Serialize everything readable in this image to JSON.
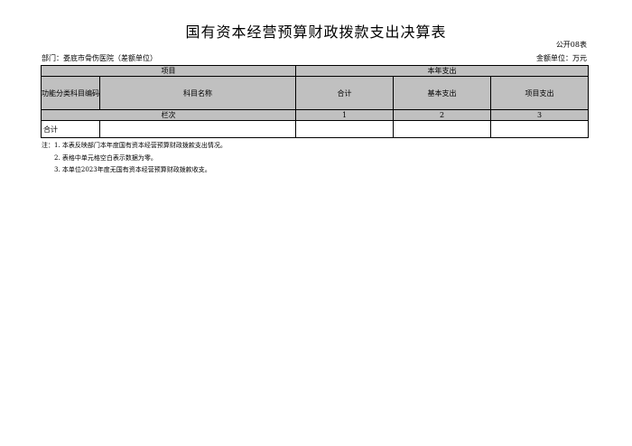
{
  "title": "国有资本经营预算财政拨款支出决算表",
  "form_no": "公开08表",
  "department": "部门：娄底市骨伤医院（差额单位）",
  "unit": "金额单位：万元",
  "table": {
    "header_project": "项目",
    "header_current_year": "本年支出",
    "col_code": "功能分类科目编码",
    "col_name": "科目名称",
    "col_total": "合计",
    "col_basic": "基本支出",
    "col_project": "项目支出",
    "row_lanci": "栏次",
    "lanci_1": "1",
    "lanci_2": "2",
    "lanci_3": "3",
    "row_total": "合计"
  },
  "notes": [
    "注：1. 本表反映部门本年度国有资本经营预算财政拨款支出情况。",
    "2. 表格中单元格空白表示数据为零。",
    "3. 本单位2023年度无国有资本经营预算财政拨款收支。"
  ]
}
